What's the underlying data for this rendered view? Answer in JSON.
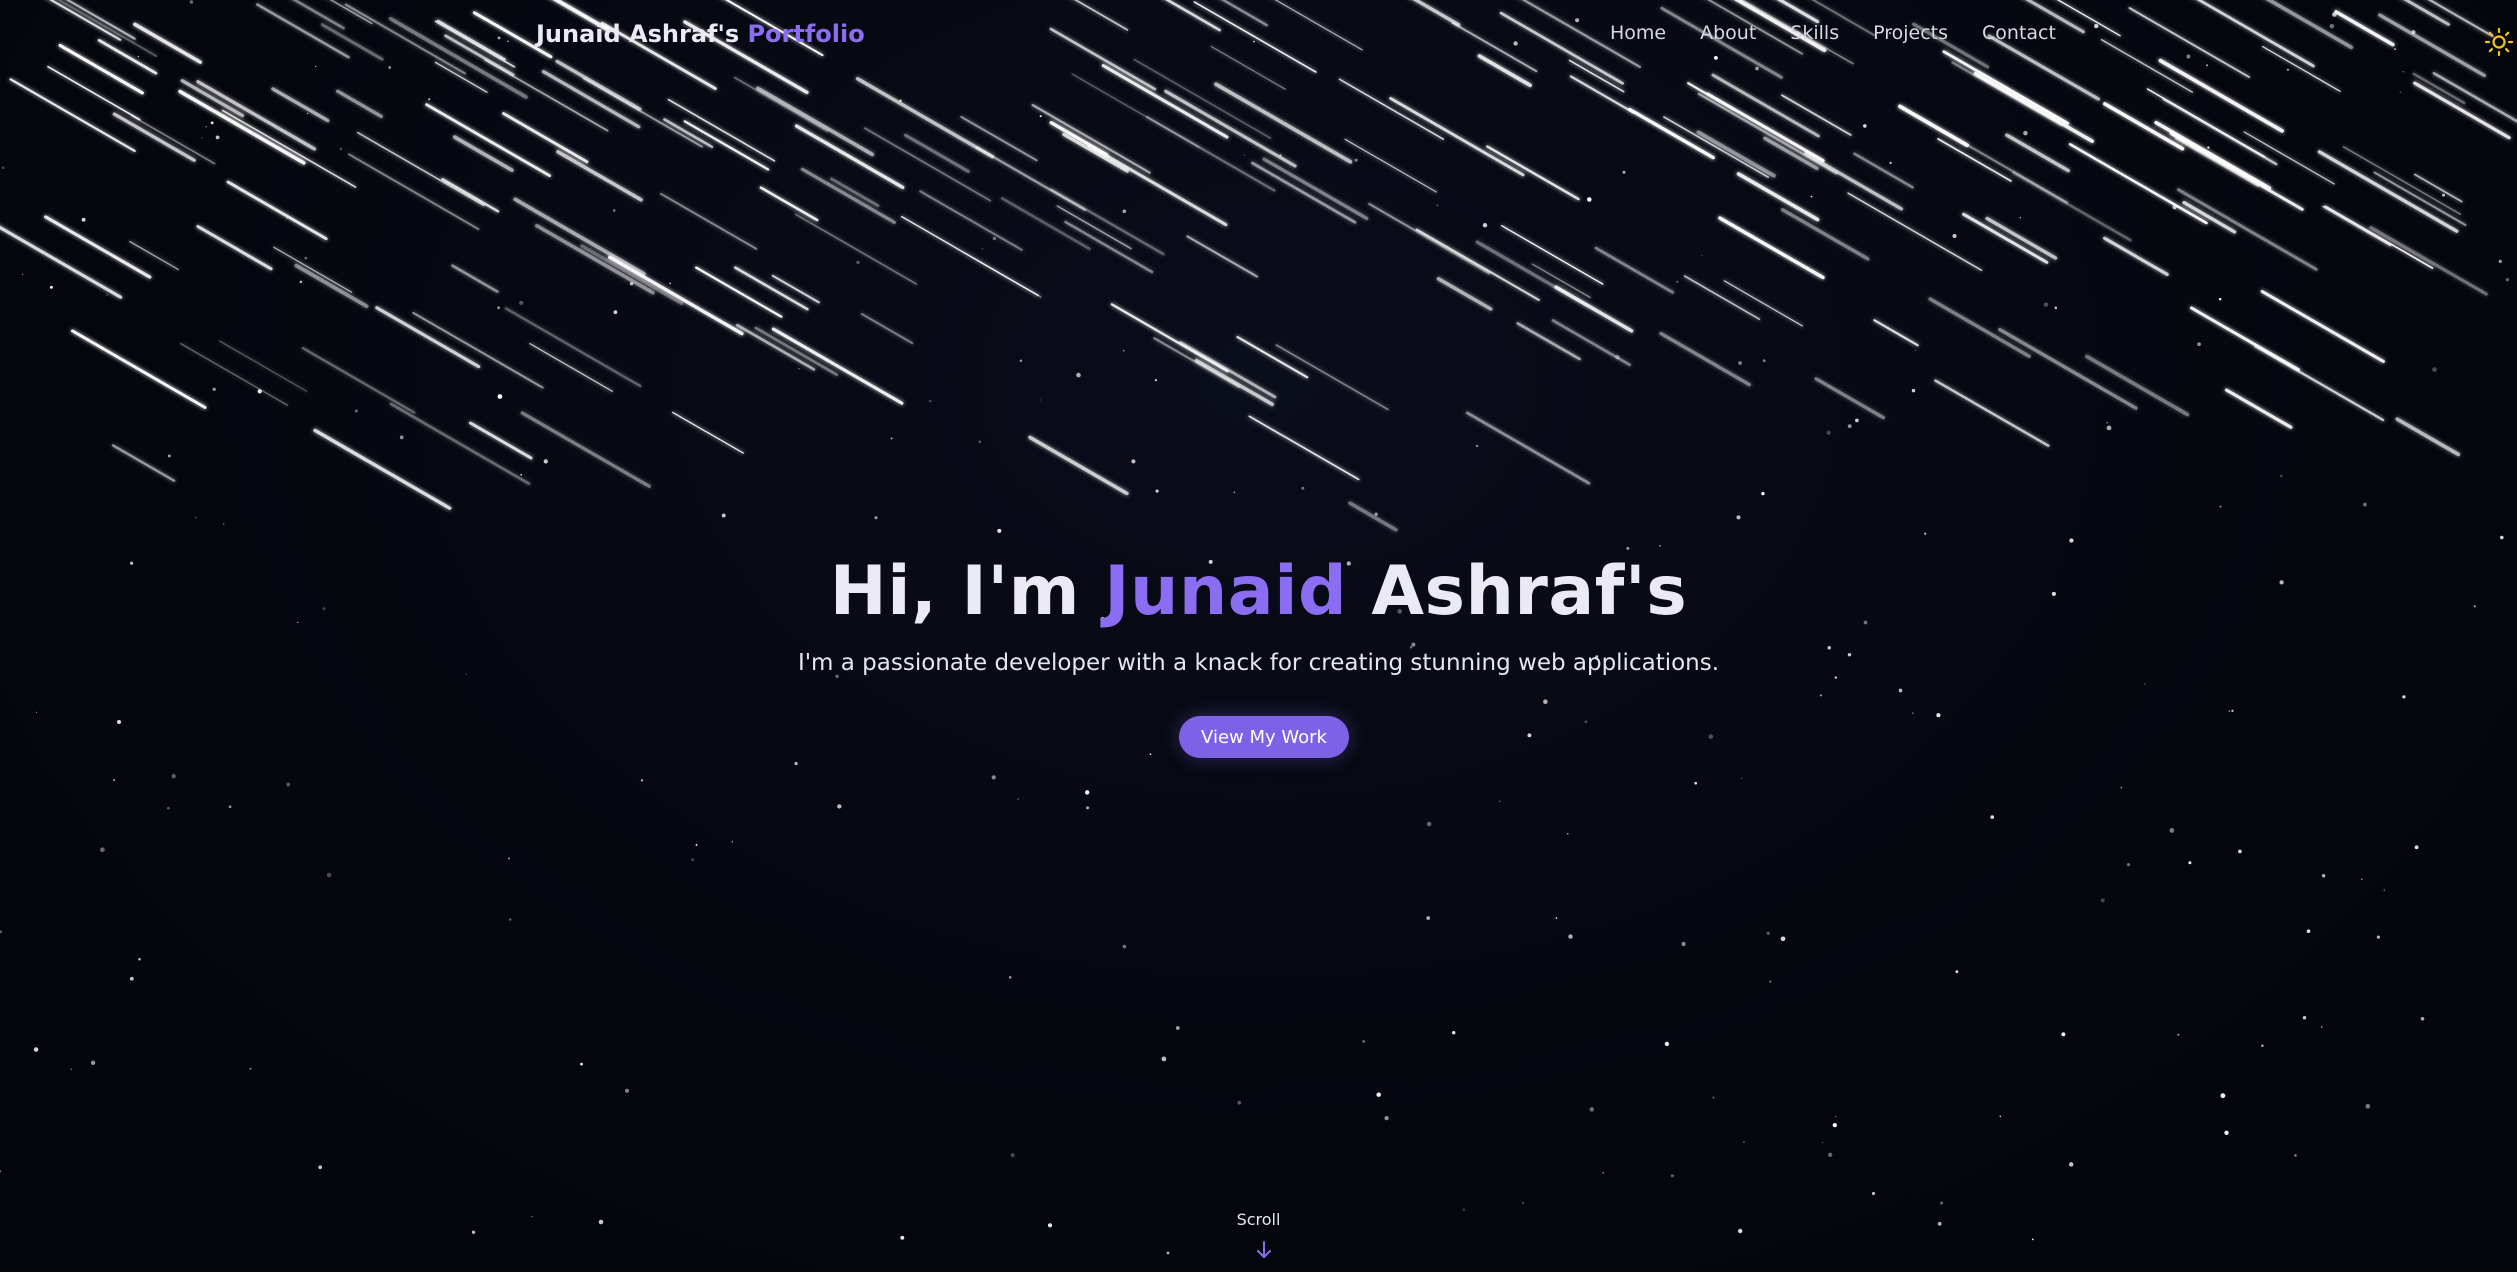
{
  "nav": {
    "brand_name": "Junaid Ashraf's",
    "brand_accent": "Portfolio",
    "links": [
      "Home",
      "About",
      "Skills",
      "Projects",
      "Contact"
    ],
    "theme_icon": "sun-icon"
  },
  "hero": {
    "title_prefix": "Hi, I'm",
    "title_accent": "Junaid",
    "title_suffix": "Ashraf's",
    "subtitle": "I'm a passionate developer with a knack for creating stunning web applications.",
    "cta_label": "View My Work"
  },
  "scroll": {
    "label": "Scroll",
    "icon": "arrow-down-icon"
  },
  "colors": {
    "background": "#05070f",
    "accent": "#8a6df0",
    "button": "#7c63e6",
    "sun": "#f5c518"
  }
}
